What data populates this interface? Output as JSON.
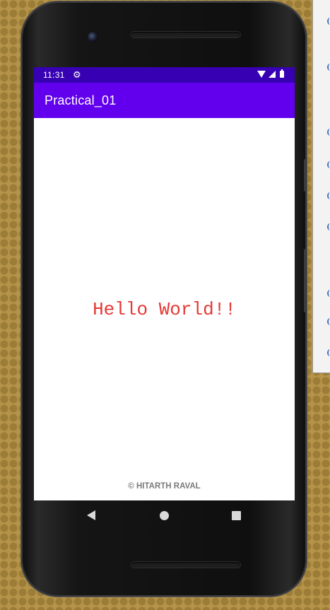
{
  "status_bar": {
    "time": "11:31",
    "icons": [
      "gear-icon",
      "wifi-icon",
      "signal-icon",
      "battery-icon"
    ]
  },
  "app_bar": {
    "title": "Practical_01"
  },
  "content": {
    "message": "Hello World!!",
    "credit": "© HITARTH RAVAL"
  },
  "nav_bar": {
    "buttons": [
      "back-icon",
      "home-icon",
      "recents-icon"
    ]
  },
  "colors": {
    "status_bar": "#3700b3",
    "app_bar": "#6200ee",
    "message_text": "#e53935",
    "credit_text": "#7a7a7a",
    "screen_background": "#ffffff"
  }
}
